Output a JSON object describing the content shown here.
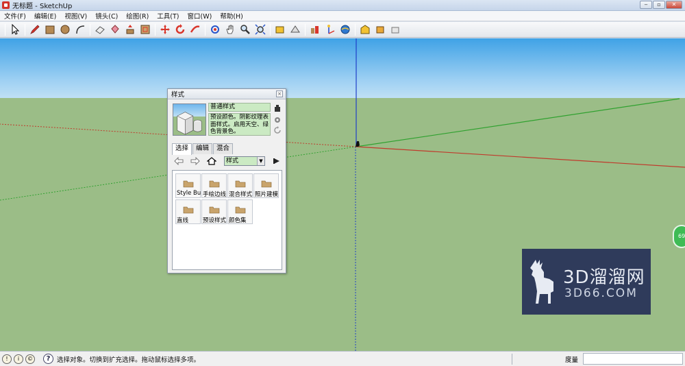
{
  "window": {
    "title": "无标题 - SketchUp"
  },
  "menu": {
    "items": [
      "文件(F)",
      "编辑(E)",
      "视图(V)",
      "镜头(C)",
      "绘图(R)",
      "工具(T)",
      "窗口(W)",
      "帮助(H)"
    ]
  },
  "toolbar": {
    "icons": [
      "select-icon",
      "pencil-icon",
      "rectangle-icon",
      "circle-icon",
      "arc-icon",
      "eraser-icon",
      "paint-bucket-icon",
      "push-pull-icon",
      "offset-icon",
      "move-icon",
      "rotate-icon",
      "follow-me-icon",
      "scale-icon",
      "orbit-icon",
      "pan-icon",
      "zoom-icon",
      "zoom-extents-icon",
      "tape-measure-icon",
      "protractor-icon",
      "section-icon",
      "axes-icon",
      "geo-location-icon",
      "model-warehouse-icon",
      "extension-icon",
      "share-icon"
    ]
  },
  "dialog": {
    "title": "样式",
    "style_name": "普通样式",
    "style_desc": "预设颜色。阴影纹理表面样式。启用天空、绿色背景色。",
    "tabs": [
      "选择",
      "编辑",
      "混合"
    ],
    "collection_select": "样式",
    "folders": [
      "Style Builder",
      "手绘边线",
      "混合样式",
      "照片建模",
      "直线",
      "预设样式",
      "颜色集"
    ]
  },
  "side_badge": "69",
  "watermark": {
    "line1": "3D溜溜网",
    "line2": "3D66.COM"
  },
  "status": {
    "text": "选择对象。切换到扩充选择。拖动鼠标选择多项。",
    "measure_label": "度量",
    "measure_value": ""
  },
  "colors": {
    "sky_top": "#3fa2e6",
    "ground": "#9bbd87",
    "axis_red": "#c0392b",
    "axis_green": "#2fa12f",
    "axis_blue": "#1f3fc9",
    "style_field": "#cbeac3"
  }
}
